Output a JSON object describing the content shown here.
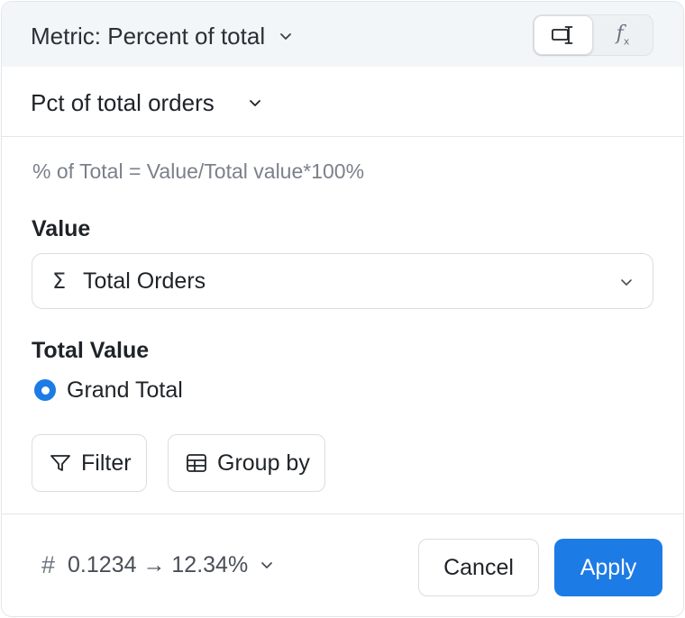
{
  "header": {
    "metric_label": "Metric: Percent of total",
    "toggle": {
      "icons": [
        "text-cursor-icon",
        "function-icon"
      ],
      "fx_text": "f",
      "fx_sub": "x"
    }
  },
  "subheader": {
    "name": "Pct of total orders"
  },
  "formula": "% of Total = Value/Total value*100%",
  "value_section": {
    "label": "Value",
    "icon": "sigma",
    "icon_glyph": "Σ",
    "selected": "Total Orders"
  },
  "total_value_section": {
    "label": "Total Value",
    "option": "Grand Total",
    "selected": true
  },
  "chips": {
    "filter_label": "Filter",
    "group_by_label": "Group by"
  },
  "footer": {
    "format_hash": "#",
    "format_example": "0.1234 → 12.34%",
    "cancel_label": "Cancel",
    "apply_label": "Apply"
  },
  "colors": {
    "accent": "#1d7be5",
    "header_bg": "#f3f6f9",
    "border": "#d9dde2",
    "muted_text": "#7b818b"
  }
}
